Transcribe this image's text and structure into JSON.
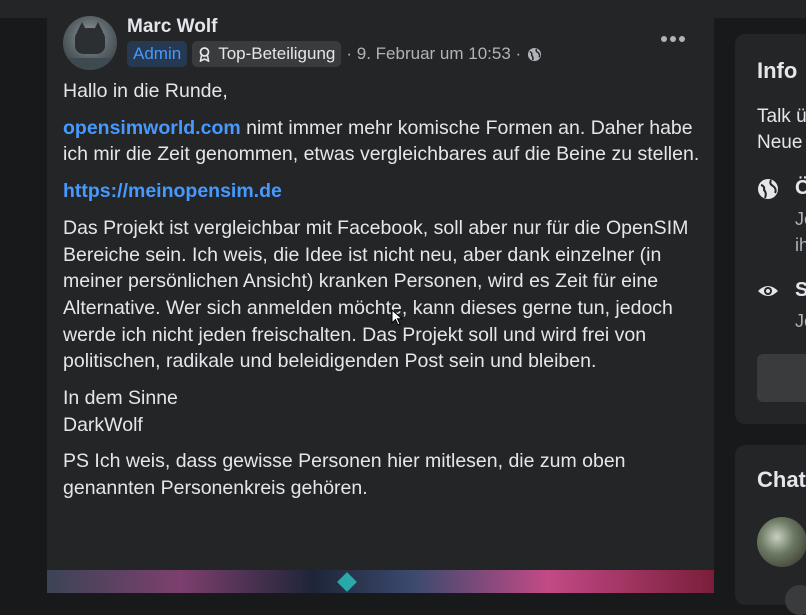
{
  "post": {
    "author": "Marc Wolf",
    "admin_badge": "Admin",
    "top_badge": "Top-Beteiligung",
    "timestamp": "· 9. Februar um 10:53 ·",
    "greeting": "Hallo in die Runde,",
    "p1_link": "opensimworld.com",
    "p1_text": " nimt immer mehr komische Formen an. Daher habe ich mir die Zeit genommen, etwas vergleichbares auf die Beine zu stellen.",
    "url": "https://meinopensim.de",
    "p2": "Das Projekt ist vergleichbar mit Facebook, soll aber nur für die OpenSIM Bereiche sein. Ich weis, die Idee ist nicht neu, aber dank einzelner (in meiner persönlichen Ansicht) kranken Personen, wird es Zeit für eine Alternative. Wer sich anmelden möchte, kann dieses gerne tun, jedoch werde ich nicht jeden freischalten. Das Projekt soll und wird frei von politischen, radikale und beleidigenden Post sein und bleiben.",
    "closing1": "In dem Sinne",
    "closing2": "DarkWolf",
    "ps": "PS Ich weis, dass gewisse Personen hier mitlesen, die zum oben genannten Personenkreis gehören."
  },
  "sidebar": {
    "info_title": "Info",
    "info_desc": "Talk ü\nNeue",
    "privacy_title": "Ö",
    "privacy_sub": "Je\nih",
    "visible_title": "S",
    "visible_sub": "Je",
    "chat_title": "Chat"
  },
  "icons": {
    "more": "more-horizontal-icon",
    "globe": "globe-icon",
    "badge": "top-contributor-icon",
    "eye": "eye-icon"
  },
  "colors": {
    "background": "#18191a",
    "card": "#242526",
    "link": "#4599ff",
    "text": "#e4e6eb",
    "secondary": "#b0b3b8"
  }
}
